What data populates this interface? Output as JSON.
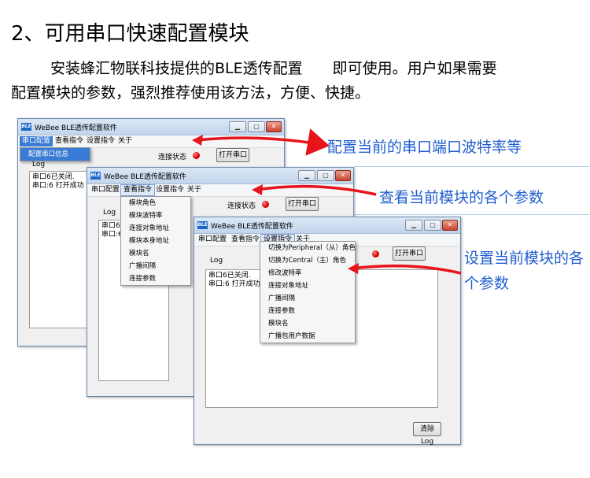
{
  "heading": "2、可用串口快速配置模块",
  "paragraph": {
    "line1": "安装蜂汇物联科技提供的BLE透传配置　　即可使用。用户如果需要",
    "line2": "配置模块的参数，强烈推荐使用该方法，方便、快捷。"
  },
  "app": {
    "logo": "BLE",
    "title": "WeBee BLE透传配置软件",
    "menus": [
      "串口配置",
      "查看指令",
      "设置指令",
      "关于"
    ],
    "min": "▁",
    "max": "▢",
    "close": "✕",
    "connect_status": "连接状态",
    "open_port": "打开串口",
    "log_label": "Log",
    "clear_log": "清除Log"
  },
  "win1": {
    "dropdown": [
      "配置串口信息"
    ],
    "log_lines": [
      "串口6已关闭.",
      "串口:6 打开成功"
    ]
  },
  "win2": {
    "dropdown": [
      "模块角色",
      "模块波特率",
      "连接对象地址",
      "模块本身地址",
      "模块名",
      "广播间隔",
      "连接参数"
    ],
    "log_lines": [
      "串口6",
      "串口:6"
    ]
  },
  "win3": {
    "dropdown": [
      "切换为Peripheral（从）角色",
      "切换为Central（主）角色",
      "修改波特率",
      "连接对象地址",
      "广播间隔",
      "连接参数",
      "模块名",
      "广播包用户数据"
    ],
    "log_lines": [
      "串口6已关闭.",
      "串口:6 打开成功"
    ]
  },
  "callouts": {
    "c1": "配置当前的串口端口波特率等",
    "c2": "查看当前模块的各个参数",
    "c3_line1": "设置当前模块的各",
    "c3_line2": "个参数"
  },
  "colors": {
    "callout_text": "#1f5ecf",
    "arrow": "#e8141b",
    "menu_highlight": "#3a7bd5"
  }
}
